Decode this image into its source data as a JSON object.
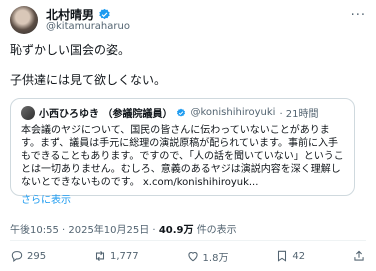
{
  "post": {
    "author_name": "北村晴男",
    "handle": "@kitamuraharuo",
    "more_label": "···",
    "line1": "恥ずかしい国会の姿。",
    "line2": "子供達には見て欲しくない。"
  },
  "quote": {
    "author_name": "小西ひろゆき （参議院議員）",
    "handle": "@konishihiroyuki",
    "time": "· 21時間",
    "text": "本会議のヤジについて、国民の皆さんに伝わっていないことがあります。まず、議員は手元に総理の演説原稿が配られています。事前に入手もできることもあります。ですので、「人の話を聞いていない」ということは一切ありません。むしろ、意義のあるヤジは演説内容を深く理解しないとできないものです。 x.com/konishihiroyuk...",
    "show_more": "さらに表示"
  },
  "meta": {
    "timestamp": "午後10:55 · 2025年10月25日 ·",
    "views": "40.9万",
    "views_label": "件の表示"
  },
  "actions": {
    "reply": "295",
    "repost": "1,777",
    "like": "1.8万",
    "bookmark": "42"
  },
  "colors": {
    "accent": "#1d9bf0",
    "muted": "#536471",
    "border": "#cfd9de"
  }
}
